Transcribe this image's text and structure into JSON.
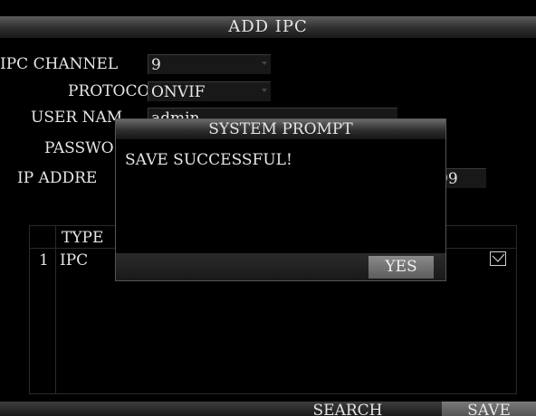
{
  "window": {
    "title": "ADD IPC"
  },
  "form": {
    "channel_label": "IPC CHANNEL",
    "channel_value": "9",
    "protocol_label": "PROTOCO",
    "protocol_value": "ONVIF",
    "username_label": "USER NAM",
    "username_value": "admin",
    "password_label": "PASSWO",
    "ip_label": "IP ADDRE",
    "ip_tail": "99"
  },
  "table": {
    "header_type": "TYPE",
    "rows": [
      {
        "index": "1",
        "type": "IPC",
        "checked": true
      }
    ]
  },
  "footer": {
    "search_label": "SEARCH",
    "save_label": "SAVE"
  },
  "dialog": {
    "title": "SYSTEM PROMPT",
    "message": "SAVE SUCCESSFUL!",
    "yes_label": "YES"
  }
}
